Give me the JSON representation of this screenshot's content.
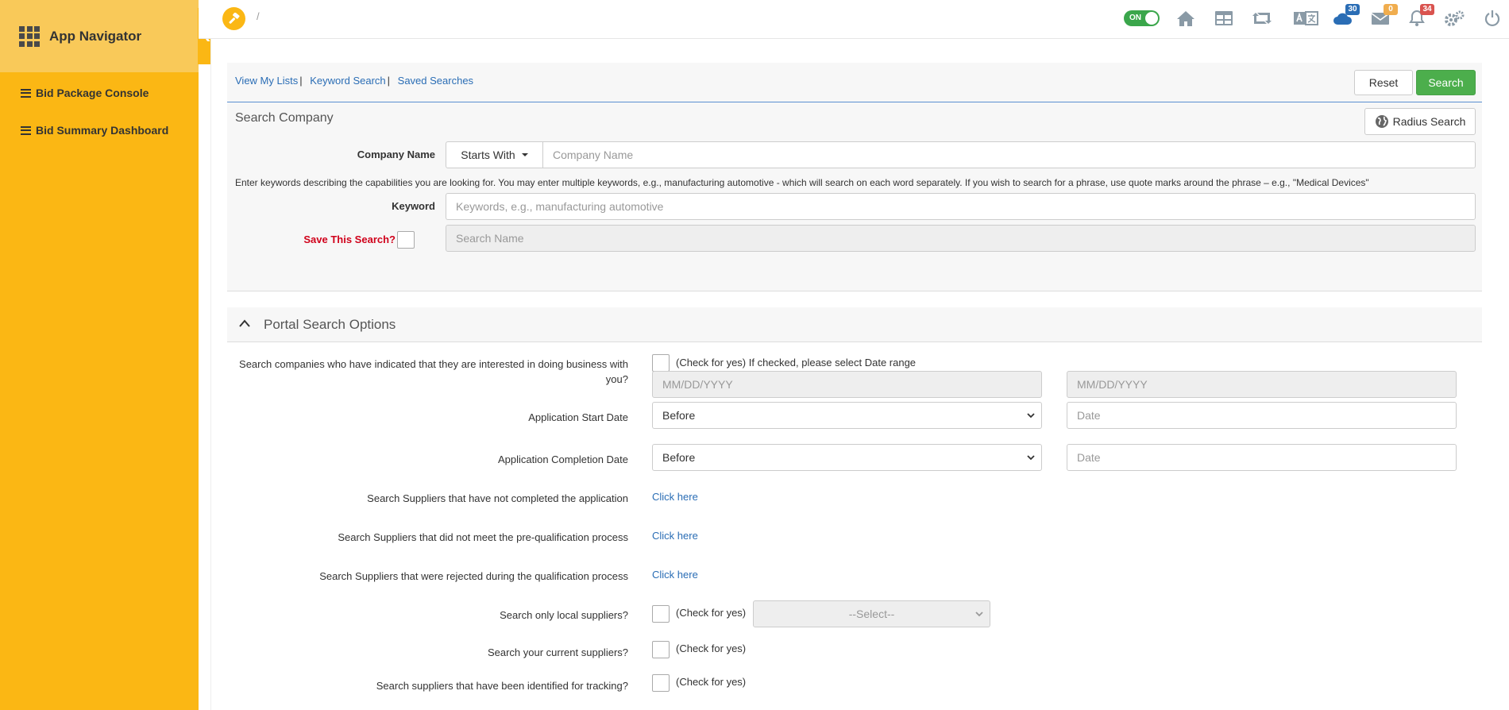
{
  "sidebar": {
    "title": "App Navigator",
    "items": [
      {
        "label": "Bid Package Console"
      },
      {
        "label": "Bid Summary Dashboard"
      }
    ]
  },
  "topbar": {
    "breadcrumb": "/",
    "toggle_label": "ON",
    "badges": {
      "cloud": "30",
      "mail": "0",
      "bell": "34"
    },
    "colors": {
      "cloud_badge": "#2a6db5",
      "mail_badge": "#f0ad4e",
      "bell_badge": "#d9534f"
    }
  },
  "links": {
    "view_my_lists": "View My Lists",
    "keyword_search": "Keyword Search",
    "saved_searches": "Saved Searches",
    "separator": "|"
  },
  "buttons": {
    "reset": "Reset",
    "search": "Search",
    "radius": "Radius Search"
  },
  "search_company": {
    "title": "Search Company",
    "company_name_label": "Company Name",
    "match_mode": "Starts With",
    "company_name_placeholder": "Company Name",
    "helper": "Enter keywords describing the capabilities you are looking for. You may enter multiple keywords, e.g., manufacturing automotive - which will search on each word separately. If you wish to search for a phrase, use quote marks around the phrase – e.g., \"Medical Devices\"",
    "keyword_label": "Keyword",
    "keyword_placeholder": "Keywords, e.g., manufacturing automotive",
    "save_label": "Save This Search?",
    "search_name_placeholder": "Search Name"
  },
  "portal_options": {
    "title": "Portal Search Options",
    "interested_label": "Search companies who have indicated that they are interested in doing business with you?",
    "interested_check": "(Check for yes) If checked, please select Date range",
    "date_placeholder": "MM/DD/YYYY",
    "app_start_label": "Application Start Date",
    "app_completion_label": "Application Completion Date",
    "before": "Before",
    "date_field_placeholder": "Date",
    "not_completed_label": "Search Suppliers that have not completed the application",
    "not_prequal_label": "Search Suppliers that did not meet the pre-qualification process",
    "rejected_label": "Search Suppliers that were rejected during the qualification process",
    "click_here": "Click here",
    "local_label": "Search only local suppliers?",
    "check_yes": "(Check for yes)",
    "select_placeholder": "--Select--",
    "current_label": "Search your current suppliers?",
    "tracking_label": "Search suppliers that have been identified for tracking?"
  }
}
